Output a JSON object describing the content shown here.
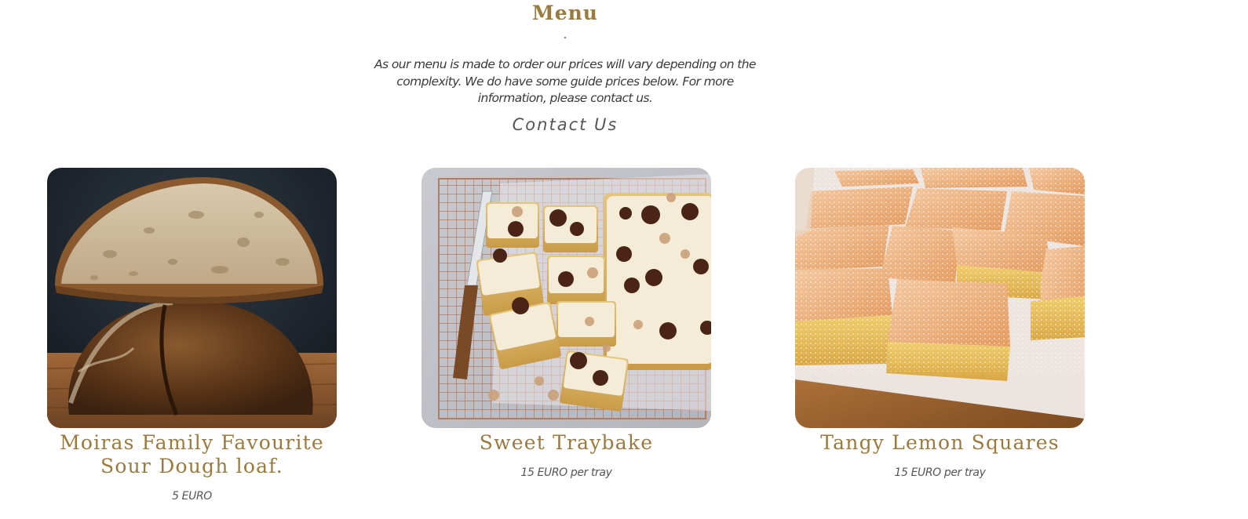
{
  "menu": {
    "title": "Menu",
    "intro": "As our menu is made to order our prices will vary depending on the complexity. We do have some guide prices below. For more information, please contact us.",
    "contact_link": "Contact Us"
  },
  "items": [
    {
      "name": "Moiras Family Favourite Sour Dough loaf.",
      "price": "5 EURO",
      "image": "sourdough-loaf-photo"
    },
    {
      "name": "Sweet Traybake",
      "price": "15 EURO per tray",
      "image": "traybake-photo"
    },
    {
      "name": "Tangy Lemon Squares",
      "price": "15 EURO per tray",
      "image": "lemon-squares-photo"
    }
  ]
}
